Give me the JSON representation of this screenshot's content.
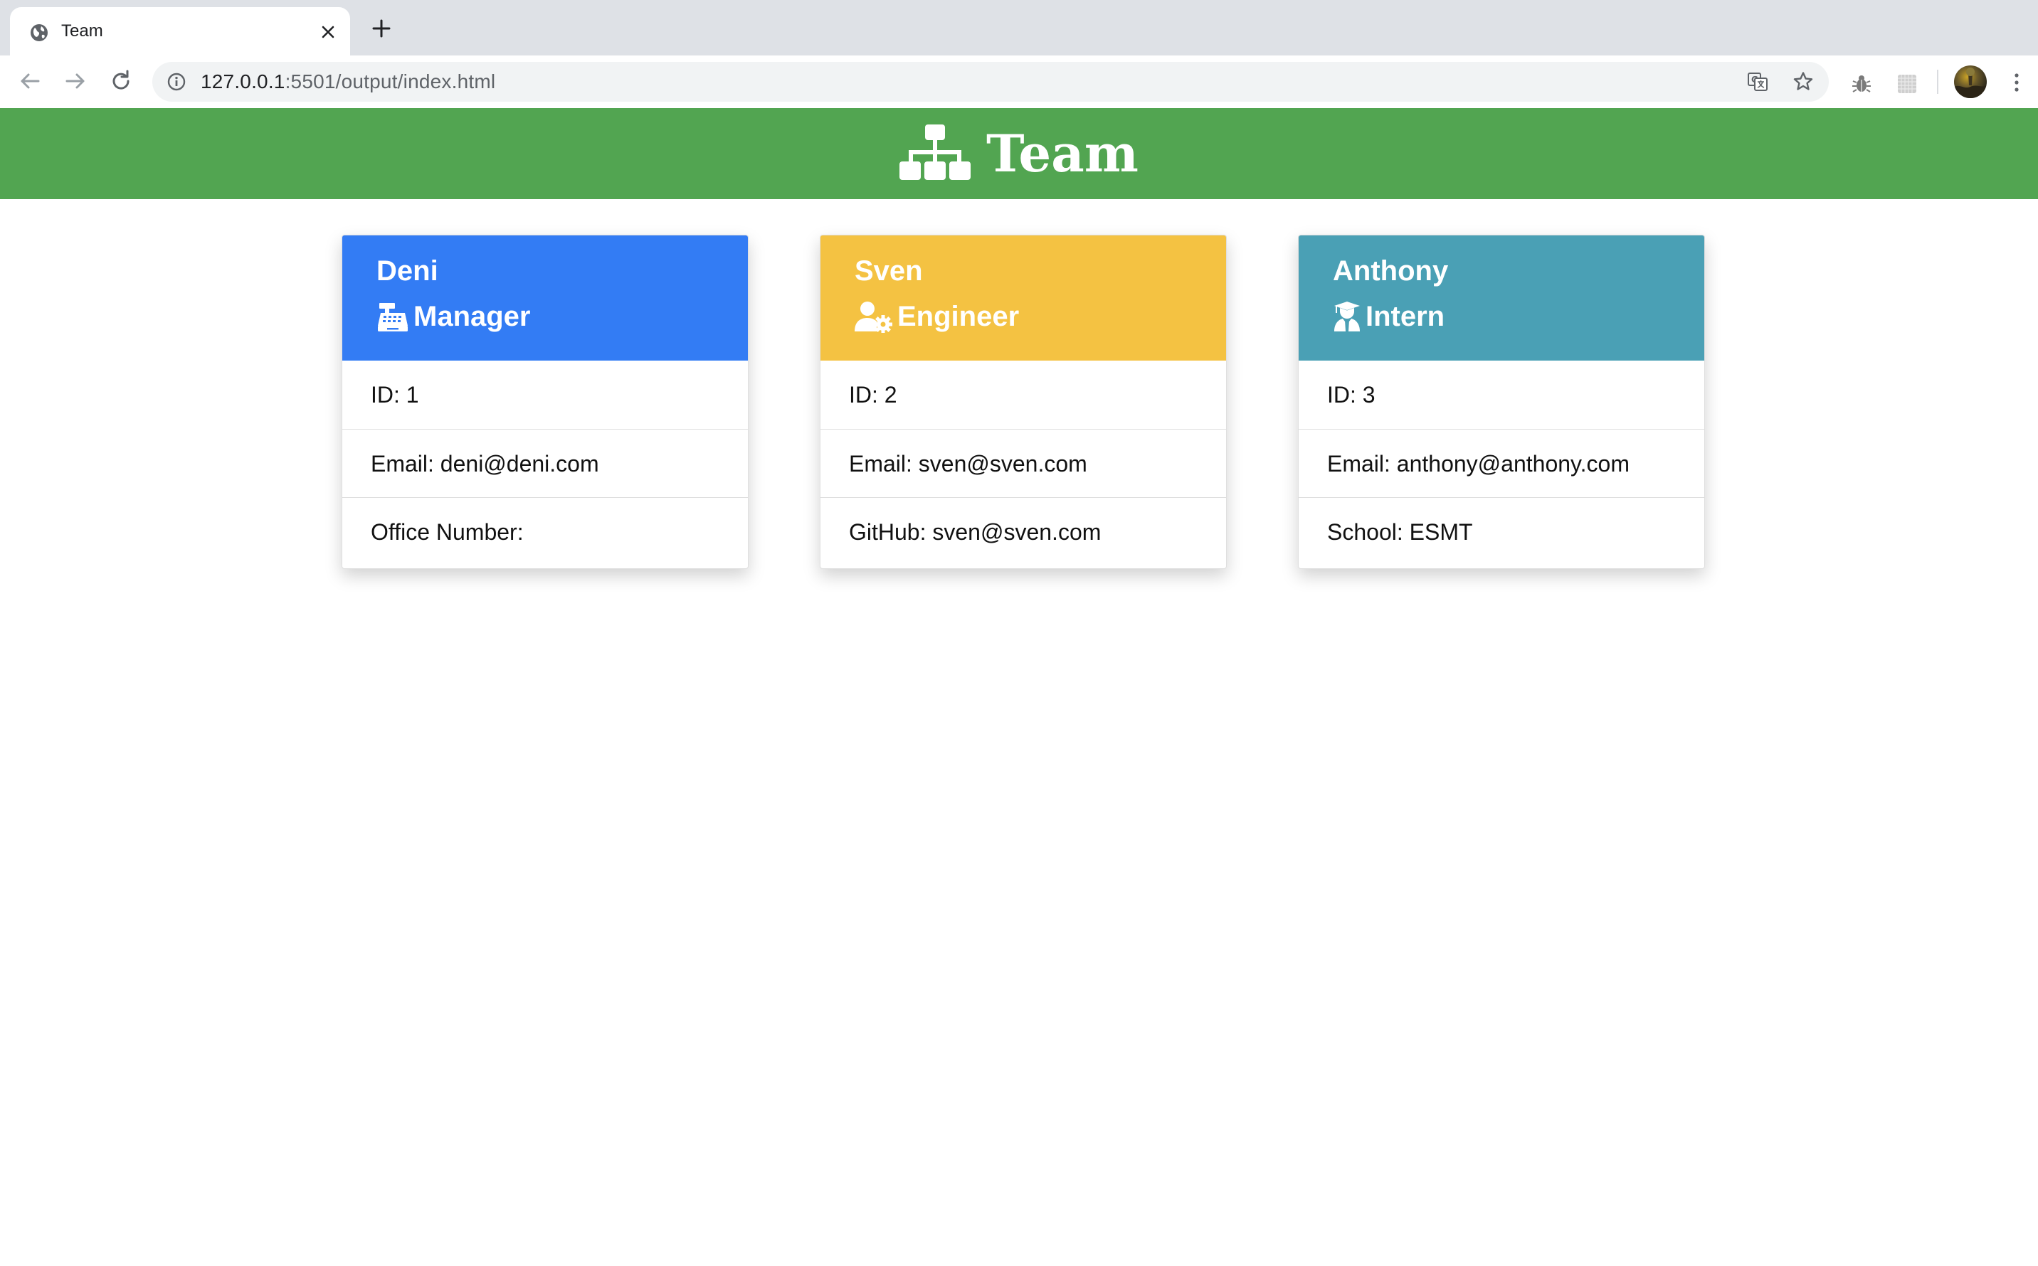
{
  "browser": {
    "tab_title": "Team",
    "url_host": "127.0.0.1",
    "url_rest": ":5501/output/index.html"
  },
  "header": {
    "title": "Team",
    "icon": "sitemap-icon",
    "background": "#52a551"
  },
  "employees": [
    {
      "name": "Deni",
      "role": "Manager",
      "role_icon": "cash-register-icon",
      "color": "#337cf4",
      "id": "ID: 1",
      "email": "Email: deni@deni.com",
      "extra": "Office Number:"
    },
    {
      "name": "Sven",
      "role": "Engineer",
      "role_icon": "user-cog-icon",
      "color": "#f4c242",
      "id": "ID: 2",
      "email": "Email: sven@sven.com",
      "extra": "GitHub: sven@sven.com"
    },
    {
      "name": "Anthony",
      "role": "Intern",
      "role_icon": "user-graduate-icon",
      "color": "#4aa0b5",
      "id": "ID: 3",
      "email": "Email: anthony@anthony.com",
      "extra": "School: ESMT"
    }
  ]
}
